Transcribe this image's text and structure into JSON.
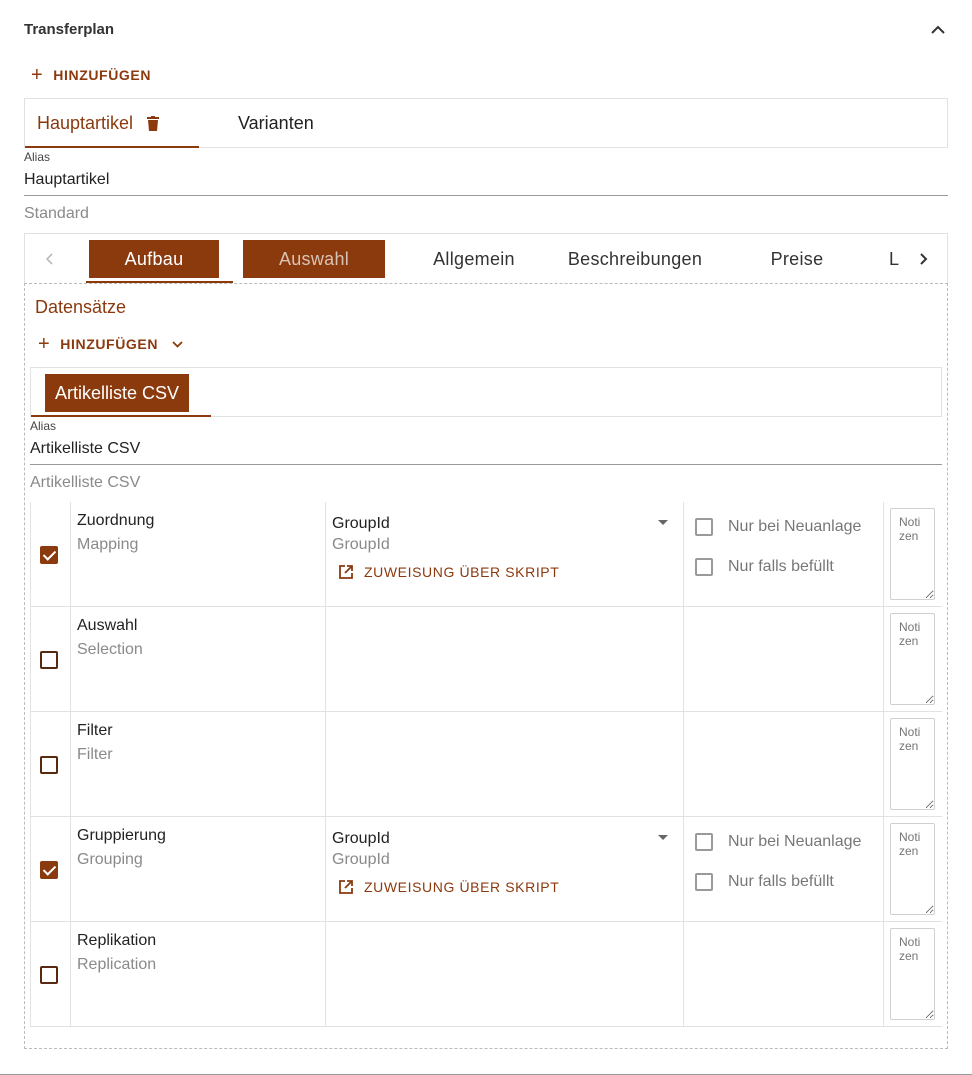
{
  "panel": {
    "title": "Transferplan",
    "add_label": "HINZUFÜGEN"
  },
  "top_tabs": [
    {
      "label": "Hauptartikel"
    },
    {
      "label": "Varianten"
    }
  ],
  "alias_field": {
    "label": "Alias",
    "value": "Hauptartikel",
    "hint": "Standard"
  },
  "inner_tabs": [
    {
      "label": "Aufbau"
    },
    {
      "label": "Auswahl"
    },
    {
      "label": "Allgemein"
    },
    {
      "label": "Beschreibungen"
    },
    {
      "label": "Preise"
    },
    {
      "label": "L"
    }
  ],
  "datasets": {
    "title": "Datensätze",
    "add_label": "HINZUFÜGEN",
    "tab": "Artikelliste CSV",
    "alias": {
      "label": "Alias",
      "value": "Artikelliste CSV",
      "hint": "Artikelliste CSV"
    }
  },
  "rows": [
    {
      "name": "Zuordnung",
      "sub": "Mapping",
      "checked": true,
      "select": "GroupId",
      "select_sub": "GroupId",
      "script": "ZUWEISUNG ÜBER SKRIPT",
      "opt1": "Nur bei Neuanlage",
      "opt2": "Nur falls befüllt",
      "notes": "Notizen"
    },
    {
      "name": "Auswahl",
      "sub": "Selection",
      "checked": false,
      "notes": "Notizen"
    },
    {
      "name": "Filter",
      "sub": "Filter",
      "checked": false,
      "notes": "Notizen"
    },
    {
      "name": "Gruppierung",
      "sub": "Grouping",
      "checked": true,
      "select": "GroupId",
      "select_sub": "GroupId",
      "script": "ZUWEISUNG ÜBER SKRIPT",
      "opt1": "Nur bei Neuanlage",
      "opt2": "Nur falls befüllt",
      "notes": "Notizen"
    },
    {
      "name": "Replikation",
      "sub": "Replication",
      "checked": false,
      "notes": "Notizen"
    }
  ],
  "colors": {
    "accent": "#8b3a0e"
  },
  "icons": {
    "collapse": "chevron-up-icon",
    "delete": "trash-icon",
    "add": "plus-icon",
    "prev": "chevron-left-icon",
    "next": "chevron-right-icon",
    "dropdown": "chevron-down-icon",
    "script": "open-external-icon"
  }
}
